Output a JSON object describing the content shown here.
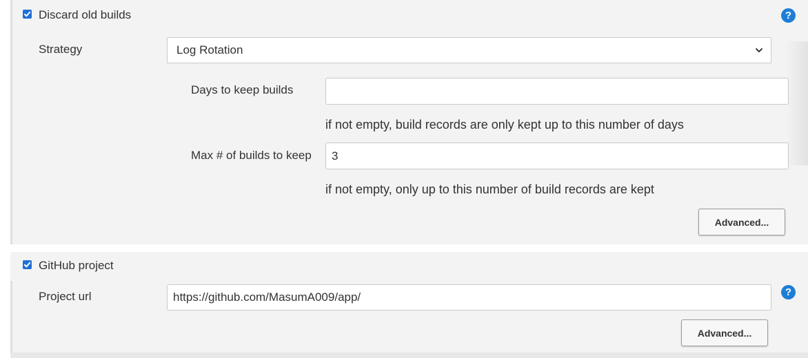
{
  "discard_section": {
    "checkbox_label": "Discard old builds",
    "checked": true,
    "strategy_label": "Strategy",
    "strategy_value": "Log Rotation",
    "days_label": "Days to keep builds",
    "days_value": "",
    "days_hint": "if not empty, build records are only kept up to this number of days",
    "max_label": "Max # of builds to keep",
    "max_value": "3",
    "max_hint": "if not empty, only up to this number of build records are kept",
    "advanced_label": "Advanced..."
  },
  "github_section": {
    "checkbox_label": "GitHub project",
    "checked": true,
    "url_label": "Project url",
    "url_value": "https://github.com/MasumA009/app/",
    "advanced_label": "Advanced..."
  },
  "icons": {
    "help": "?",
    "help_color": "#1e7ed6",
    "checkbox_color": "#1f6fd6"
  }
}
